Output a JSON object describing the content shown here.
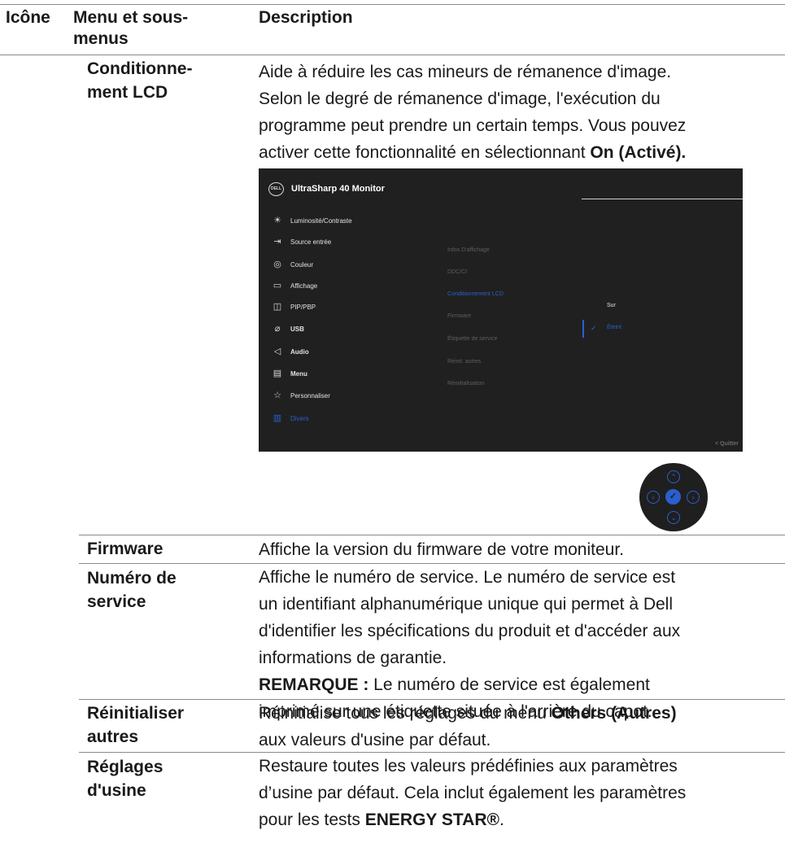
{
  "header": {
    "col_icon": "Icône",
    "col_menu": [
      "Menu et sous-",
      "menus"
    ],
    "col_description": "Description"
  },
  "lcd": {
    "name": [
      "Conditionne-",
      "ment LCD"
    ],
    "desc_lines": [
      "Aide à réduire les cas mineurs de rémanence d'image.",
      "Selon le degré de rémanence d'image, l'exécution du",
      "programme peut prendre un certain temps. Vous pouvez"
    ],
    "desc_last_prefix": "activer cette fonctionnalité en sélectionnant ",
    "desc_last_bold": "On (Activé)."
  },
  "osd": {
    "logo": "DELL",
    "title": "UltraSharp 40 Monitor",
    "menu": [
      {
        "icon": "brightness-icon",
        "glyph": "☀",
        "label": "Luminosité/Contraste",
        "bold": false,
        "selected": false
      },
      {
        "icon": "input-source-icon",
        "glyph": "⇥",
        "label": "Source entrée",
        "bold": false,
        "selected": false
      },
      {
        "icon": "color-icon",
        "glyph": "◎",
        "label": "Couleur",
        "bold": false,
        "selected": false
      },
      {
        "icon": "display-icon",
        "glyph": "▭",
        "label": "Affichage",
        "bold": false,
        "selected": false
      },
      {
        "icon": "pip-pbp-icon",
        "glyph": "◫",
        "label": "PIP/PBP",
        "bold": false,
        "selected": false
      },
      {
        "icon": "usb-icon",
        "glyph": "⌀",
        "label": "USB",
        "bold": true,
        "selected": false
      },
      {
        "icon": "audio-icon",
        "glyph": "◁",
        "label": "Audio",
        "bold": true,
        "selected": false
      },
      {
        "icon": "menu-icon",
        "glyph": "▤",
        "label": "Menu",
        "bold": true,
        "selected": false
      },
      {
        "icon": "star-icon",
        "glyph": "☆",
        "label": "Personnaliser",
        "bold": false,
        "selected": false
      },
      {
        "icon": "others-icon",
        "glyph": "▥",
        "label": "Divers",
        "bold": false,
        "selected": true
      }
    ],
    "submenu": [
      {
        "label": "Infos D'affichage",
        "selected": false
      },
      {
        "label": "DDC/CI",
        "selected": false
      },
      {
        "label": "Conditionnement LCD",
        "selected": true
      },
      {
        "label": "Firmware",
        "selected": false
      },
      {
        "label": "Étiquette de service",
        "selected": false
      },
      {
        "label": "Réinit. autres",
        "selected": false
      },
      {
        "label": "Réinitialisation",
        "selected": false
      }
    ],
    "options": [
      {
        "label": "Sur",
        "selected": false
      },
      {
        "label": "Éteint",
        "selected": true
      }
    ],
    "check_glyph": "✓",
    "quit": "< Quitter"
  },
  "joystick": {
    "up": "⌃",
    "down": "⌄",
    "left": "‹",
    "right": "›",
    "center": "✓"
  },
  "rows": {
    "firmware": {
      "name": "Firmware",
      "desc": "Affiche la version du firmware de votre moniteur."
    },
    "service": {
      "name": [
        "Numéro de",
        "service"
      ],
      "desc_lines": [
        "Affiche le numéro de service. Le numéro de service est",
        "un identifiant alphanumérique unique qui permet à Dell",
        "d'identifier les spécifications du produit et d'accéder aux",
        "informations de garantie."
      ],
      "note_bold": "REMARQUE :",
      "note_rest": " Le numéro de service est également",
      "note_line2": "imprimé sur une étiquette située à l'arrière du capot."
    },
    "reset_others": {
      "name": [
        "Réinitialiser",
        "autres"
      ],
      "desc_prefix": "Réinitialise tous les réglages du menu ",
      "desc_bold": "Others (Autres)",
      "desc_line2": "aux valeurs d'usine par défaut."
    },
    "factory": {
      "name": [
        "Réglages",
        "d'usine"
      ],
      "desc_line1": "Restaure toutes les valeurs prédéfinies aux paramètres",
      "desc_line2": "d’usine par défaut. Cela inclut également les paramètres",
      "desc_prefix3": "pour les tests ",
      "desc_bold3": "ENERGY STAR®",
      "desc_suffix3": "."
    }
  }
}
